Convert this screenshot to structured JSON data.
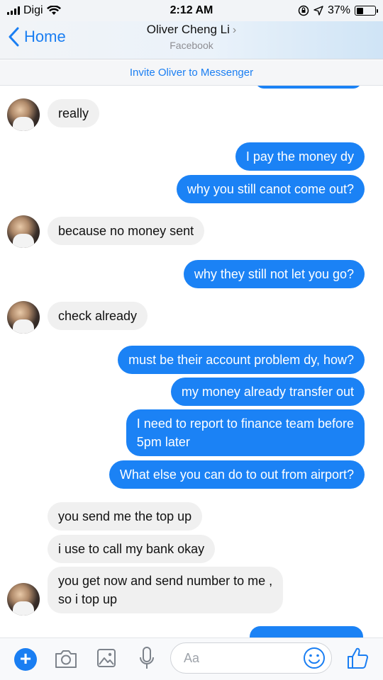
{
  "status": {
    "carrier": "Digi",
    "time": "2:12 AM",
    "battery": "37%"
  },
  "header": {
    "back_label": "Home",
    "contact_name": "Oliver Cheng Li",
    "subtitle": "Facebook"
  },
  "invite": {
    "label": "Invite Oliver to Messenger"
  },
  "messages": [
    {
      "dir": "in",
      "text": "really"
    },
    {
      "dir": "out",
      "text": "I pay the money dy"
    },
    {
      "dir": "out",
      "text": "why you still canot come out?"
    },
    {
      "dir": "in",
      "text": "because no money sent"
    },
    {
      "dir": "out",
      "text": "why they still not let you go?"
    },
    {
      "dir": "in",
      "text": "check already"
    },
    {
      "dir": "out",
      "text": "must be their account problem dy, how?"
    },
    {
      "dir": "out",
      "text": "my money already transfer out"
    },
    {
      "dir": "out",
      "text": "I need to report to finance team before\n5pm later"
    },
    {
      "dir": "out",
      "text": "What else you can do to out from airport?"
    },
    {
      "dir": "in",
      "text": "you send me the top up"
    },
    {
      "dir": "in",
      "text": "i use to call my bank okay"
    },
    {
      "dir": "in",
      "text": "you get now and send number to me ,\nso i top up"
    }
  ],
  "composer": {
    "placeholder": "Aa"
  },
  "colors": {
    "accent": "#1a7ef2",
    "outgoing": "#1b82f5",
    "incoming": "#f0f0f0"
  },
  "icons": [
    "plus-icon",
    "camera-icon",
    "image-icon",
    "microphone-icon",
    "smiley-icon",
    "thumbs-up-icon"
  ]
}
